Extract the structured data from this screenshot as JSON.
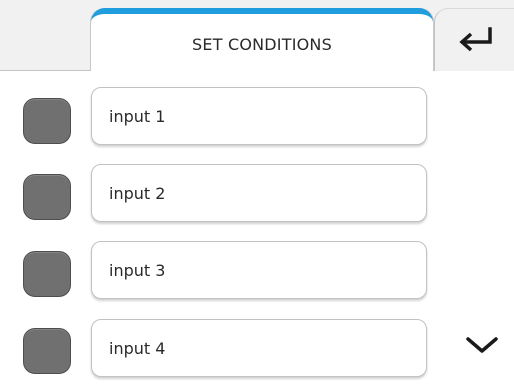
{
  "header": {
    "title": "SET CONDITIONS",
    "back_icon": "return-arrow-icon",
    "accent_color": "#1f9ddf"
  },
  "rows": [
    {
      "label": "input 1",
      "checked": false
    },
    {
      "label": "input 2",
      "checked": false
    },
    {
      "label": "input 3",
      "checked": false
    },
    {
      "label": "input 4",
      "checked": false
    }
  ],
  "scroll": {
    "icon": "chevron-down-icon"
  }
}
